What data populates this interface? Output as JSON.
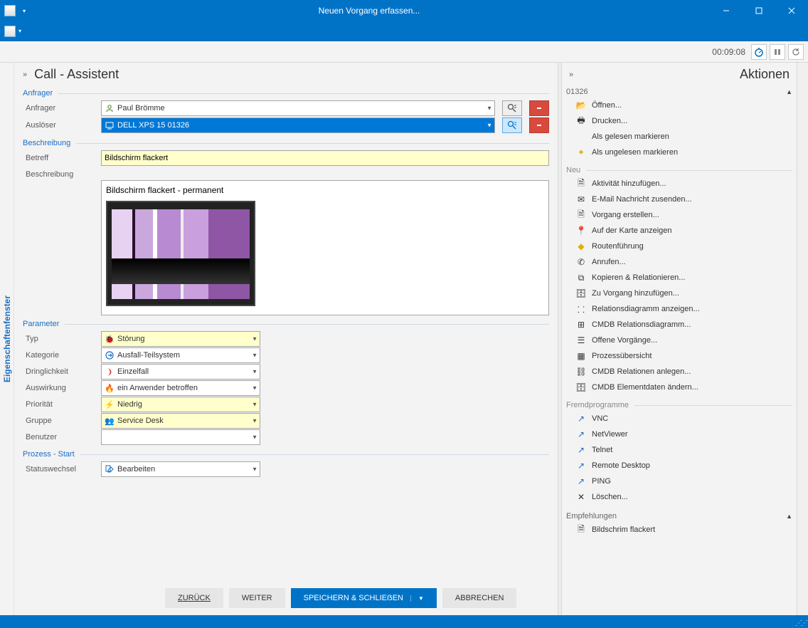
{
  "window": {
    "title": "Neuen Vorgang erfassen...",
    "minimize_label": "Minimize",
    "maximize_label": "Maximize",
    "close_label": "Close"
  },
  "timer": {
    "value": "00:09:08"
  },
  "toolbar_top": {
    "start_label": "Start",
    "pause_label": "Pause",
    "reset_label": "Reset"
  },
  "left_vtab": {
    "label": "Eigenschaftenfenster"
  },
  "call": {
    "title": "Call - Assistent",
    "sections": {
      "anfrager": "Anfrager",
      "beschreibung": "Beschreibung",
      "parameter": "Parameter",
      "prozess": "Prozess - Start"
    },
    "fields": {
      "anfrager_label": "Anfrager",
      "anfrager_value": "Paul Brömme",
      "ausloeser_label": "Auslöser",
      "ausloeser_value": "DELL XPS 15 01326",
      "betreff_label": "Betreff",
      "betreff_value": "Bildschirm flackert",
      "beschreibung_label": "Beschreibung",
      "beschreibung_value": "Bildschirm flackert - permanent",
      "typ_label": "Typ",
      "typ_value": "Störung",
      "kategorie_label": "Kategorie",
      "kategorie_value": "Ausfall-Teilsystem",
      "dringlichkeit_label": "Dringlichkeit",
      "dringlichkeit_value": "Einzelfall",
      "auswirkung_label": "Auswirkung",
      "auswirkung_value": "ein Anwender betroffen",
      "prioritaet_label": "Priorität",
      "prioritaet_value": "Niedrig",
      "gruppe_label": "Gruppe",
      "gruppe_value": "Service Desk",
      "benutzer_label": "Benutzer",
      "benutzer_value": "",
      "statuswechsel_label": "Statuswechsel",
      "statuswechsel_value": "Bearbeiten"
    },
    "buttons": {
      "back": "ZURÜCK",
      "next": "WEITER",
      "save_close": "SPEICHERN & SCHLIEẞEN",
      "cancel": "ABBRECHEN"
    }
  },
  "actions": {
    "title": "Aktionen",
    "id": "01326",
    "groups": {
      "neu": "Neu",
      "fremd": "Fremdprogramme",
      "empfehlungen": "Empfehlungen"
    },
    "items": {
      "open": "Öffnen...",
      "print": "Drucken...",
      "mark_read": "Als gelesen markieren",
      "mark_unread": "Als ungelesen markieren",
      "add_activity": "Aktivität hinzufügen...",
      "send_mail": "E-Mail Nachricht zusenden...",
      "create_proc": "Vorgang erstellen...",
      "show_map": "Auf der Karte anzeigen",
      "routing": "Routenführung",
      "call": "Anrufen...",
      "copy_rel": "Kopieren & Relationieren...",
      "add_to_proc": "Zu Vorgang hinzufügen...",
      "rel_diagram": "Relationsdiagramm anzeigen...",
      "cmdb_rel_diag": "CMDB Relationsdiagramm...",
      "open_procs": "Offene Vorgänge...",
      "proc_overview": "Prozessübersicht",
      "cmdb_rel_create": "CMDB Relationen anlegen...",
      "cmdb_elem_edit": "CMDB Elementdaten ändern...",
      "vnc": "VNC",
      "netviewer": "NetViewer",
      "telnet": "Telnet",
      "rdp": "Remote Desktop",
      "ping": "PING",
      "delete": "Löschen...",
      "recom1": "Bildschrim flackert"
    }
  }
}
